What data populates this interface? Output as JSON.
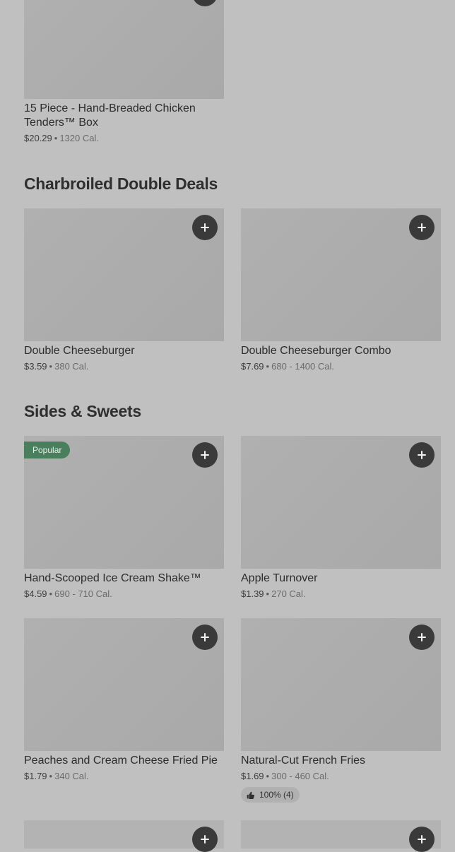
{
  "sections": {
    "charbroiled": {
      "title": "Charbroiled Double Deals"
    },
    "sides": {
      "title": "Sides & Sweets"
    }
  },
  "items": {
    "tenders": {
      "name": "15 Piece - Hand-Breaded Chicken Tenders™ Box",
      "price": "$20.29",
      "calories": "1320 Cal."
    },
    "double_cheeseburger": {
      "name": "Double Cheeseburger",
      "price": "$3.59",
      "calories": "380 Cal."
    },
    "double_cheeseburger_combo": {
      "name": "Double Cheeseburger Combo",
      "price": "$7.69",
      "calories": "680 - 1400 Cal."
    },
    "shake": {
      "name": "Hand-Scooped Ice Cream Shake™",
      "price": "$4.59",
      "calories": "690 - 710 Cal.",
      "badge": "Popular"
    },
    "apple_turnover": {
      "name": "Apple Turnover",
      "price": "$1.39",
      "calories": "270 Cal."
    },
    "fried_pie": {
      "name": "Peaches and Cream Cheese Fried Pie",
      "price": "$1.79",
      "calories": "340 Cal."
    },
    "fries": {
      "name": "Natural-Cut French Fries",
      "price": "$1.69",
      "calories": "300 - 460 Cal.",
      "rating": "100% (4)"
    }
  },
  "separator": "•",
  "colors": {
    "background": "#c0c0c0",
    "add_button": "#3a3a3a",
    "popular_badge": "#4a7f5e"
  },
  "icons": {
    "add": "plus-icon",
    "rating": "thumbs-up-icon"
  }
}
